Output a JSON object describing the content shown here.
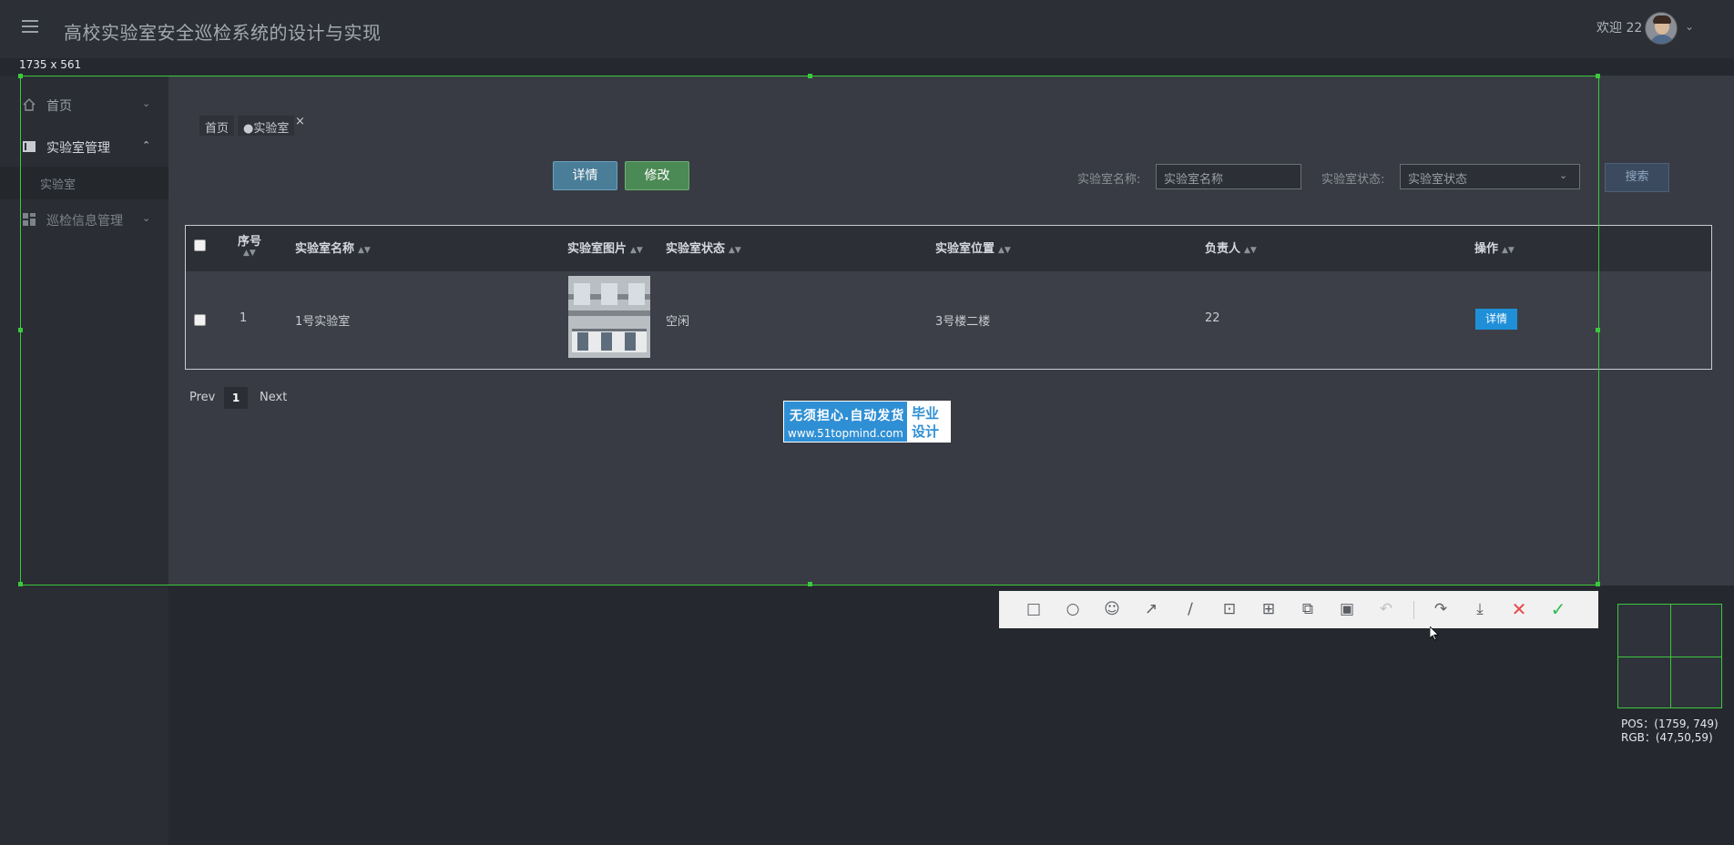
{
  "header": {
    "title": "高校实验室安全巡检系统的设计与实现",
    "welcome": "欢迎 22"
  },
  "sidebar": {
    "items": [
      {
        "label": "首页",
        "icon": "home-icon"
      },
      {
        "label": "实验室管理",
        "icon": "table-icon"
      },
      {
        "label": "巡检信息管理",
        "icon": "grid-icon"
      }
    ],
    "sub_items": [
      {
        "label": "实验室"
      }
    ]
  },
  "tabs": [
    {
      "label": "首页"
    },
    {
      "label": "●实验室"
    }
  ],
  "tab_close": "×",
  "toolbar_buttons": {
    "detail": "详情",
    "edit": "修改"
  },
  "filters": {
    "name_label": "实验室名称:",
    "name_placeholder": "实验室名称",
    "status_label": "实验室状态:",
    "status_value": "实验室状态",
    "search": "搜索"
  },
  "table": {
    "columns": [
      "序号",
      "实验室名称",
      "实验室图片",
      "实验室状态",
      "实验室位置",
      "负责人",
      "操作"
    ],
    "rows": [
      {
        "index": "1",
        "name": "1号实验室",
        "status": "空闲",
        "location": "3号楼二楼",
        "owner": "22",
        "action": "详情"
      }
    ]
  },
  "pagination": {
    "prev": "Prev",
    "current": "1",
    "next": "Next"
  },
  "banner": {
    "line1": "无须担心.自动发货",
    "line2": "www.51topmind.com",
    "box_line1": "毕业",
    "box_line2": "设计"
  },
  "capture": {
    "dimensions": "1735 x 561",
    "pos": "POS：(1759, 749)",
    "rgb": "RGB：(47,50,59)"
  },
  "colors": {
    "selection_border": "#3cc83c",
    "accent_blue": "#1f8fd8",
    "detail_button": "#4a7d98",
    "edit_button": "#4c8a55"
  }
}
